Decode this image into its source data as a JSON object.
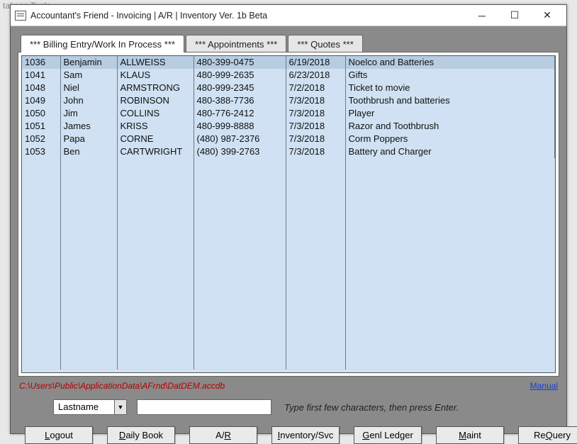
{
  "bg_hint": "tabase Tools",
  "window": {
    "title": "Accountant's Friend - Invoicing | A/R | Inventory Ver. 1b Beta"
  },
  "tabs": [
    {
      "label": "*** Billing Entry/Work In Process ***",
      "active": true
    },
    {
      "label": "*** Appointments ***",
      "active": false
    },
    {
      "label": "*** Quotes ***",
      "active": false
    }
  ],
  "grid": {
    "rows": [
      {
        "id": "1036",
        "first": "Benjamin",
        "last": "ALLWEISS",
        "phone": "480-399-0475",
        "date": "6/19/2018",
        "desc": "Noelco and Batteries"
      },
      {
        "id": "1041",
        "first": "Sam",
        "last": "KLAUS",
        "phone": "480-999-2635",
        "date": "6/23/2018",
        "desc": "Gifts"
      },
      {
        "id": "1048",
        "first": "Niel",
        "last": "ARMSTRONG",
        "phone": "480-999-2345",
        "date": "7/2/2018",
        "desc": "Ticket to movie"
      },
      {
        "id": "1049",
        "first": "John",
        "last": "ROBINSON",
        "phone": "480-388-7736",
        "date": "7/3/2018",
        "desc": "Toothbrush and batteries"
      },
      {
        "id": "1050",
        "first": "Jim",
        "last": "COLLINS",
        "phone": "480-776-2412",
        "date": "7/3/2018",
        "desc": "Player"
      },
      {
        "id": "1051",
        "first": "James",
        "last": "KRISS",
        "phone": "480-999-8888",
        "date": "7/3/2018",
        "desc": "Razor and Toothbrush"
      },
      {
        "id": "1052",
        "first": "Papa",
        "last": "CORNE",
        "phone": "(480) 987-2376",
        "date": "7/3/2018",
        "desc": "Corm Poppers"
      },
      {
        "id": "1053",
        "first": "Ben",
        "last": "CARTWRIGHT",
        "phone": "(480) 399-2763",
        "date": "7/3/2018",
        "desc": "Battery and Charger"
      }
    ]
  },
  "db_path": "C:\\Users\\Public\\ApplicationData\\AFrnd\\DatDEM.accdb",
  "manual_link": "Manual",
  "search": {
    "combo_value": "Lastname",
    "input_value": "",
    "hint": "Type first few characters, then press Enter."
  },
  "buttons": {
    "logout": {
      "pre": "",
      "u": "L",
      "post": "ogout"
    },
    "dailybook": {
      "pre": "",
      "u": "D",
      "post": "aily Book"
    },
    "ar": {
      "pre": "A/",
      "u": "R",
      "post": ""
    },
    "inventory": {
      "pre": "",
      "u": "I",
      "post": "nventory/Svc"
    },
    "genlledger": {
      "pre": "",
      "u": "G",
      "post": "enl Ledger"
    },
    "maint": {
      "pre": "",
      "u": "M",
      "post": "aint"
    },
    "requery": {
      "pre": "Re",
      "u": "Q",
      "post": "uery"
    }
  }
}
